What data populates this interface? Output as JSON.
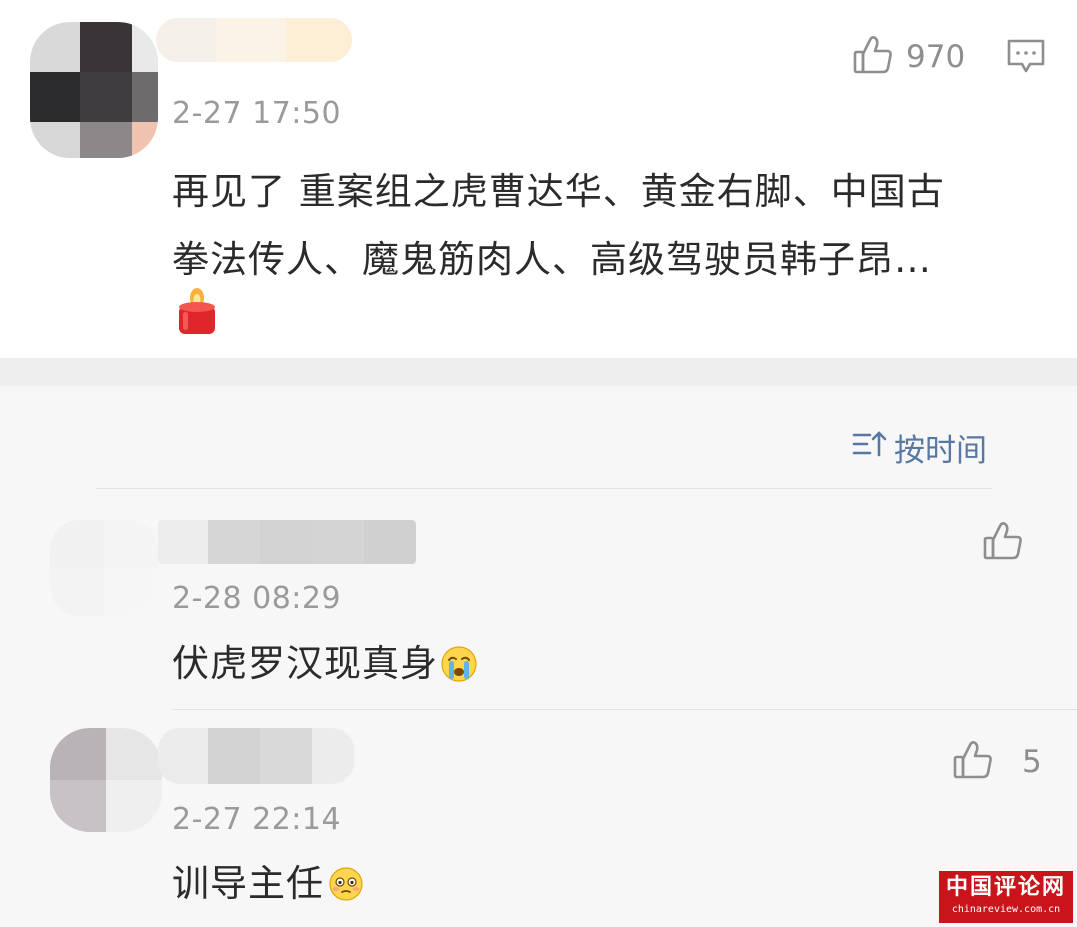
{
  "main_comment": {
    "timestamp": "2-27 17:50",
    "like_count": "970",
    "text_line1": "再见了 重案组之虎曹达华、黄金右脚、中国古",
    "text_line2": "拳法传人、魔鬼筋肉人、高级驾驶员韩子昂…",
    "emoji": "candle-icon"
  },
  "sort": {
    "label": "按时间"
  },
  "replies": [
    {
      "timestamp": "2-28 08:29",
      "text": "伏虎罗汉现真身",
      "emoji": "crying-face-icon",
      "like_count": ""
    },
    {
      "timestamp": "2-27 22:14",
      "text": "训导主任",
      "emoji": "flushed-face-icon",
      "like_count": "5"
    }
  ],
  "watermark": {
    "title": "中国评论网",
    "url": "chinareview.com.cn"
  },
  "colors": {
    "accent_link": "#5878a3",
    "watermark_bg": "#c8141a"
  }
}
